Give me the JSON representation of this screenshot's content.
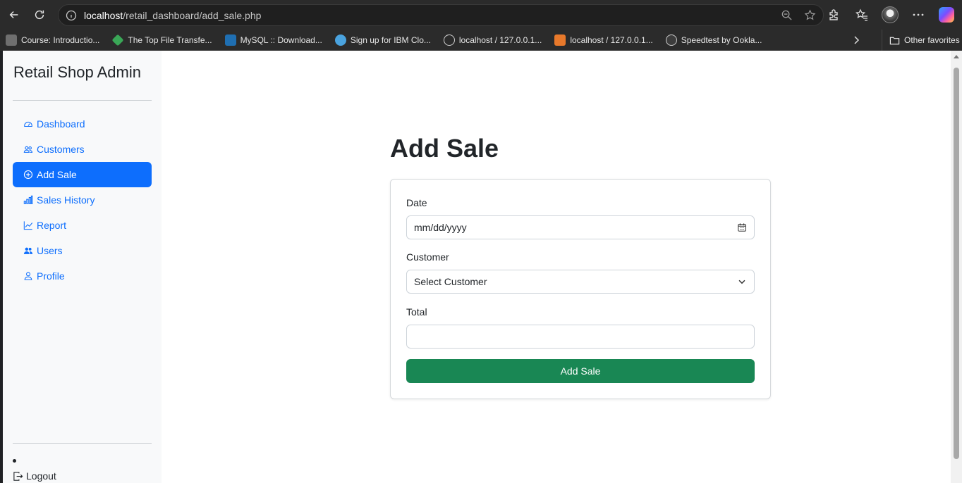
{
  "browser": {
    "url_host": "localhost",
    "url_path": "/retail_dashboard/add_sale.php",
    "bookmarks": [
      {
        "label": "Course: Introductio...",
        "color": "#6f6f6f"
      },
      {
        "label": "The Top File Transfe...",
        "color": "#3aa757"
      },
      {
        "label": "MySQL :: Download...",
        "color": "#1f6fb2"
      },
      {
        "label": "Sign up for IBM Clo...",
        "color": "#4aa3df"
      },
      {
        "label": "localhost / 127.0.0.1...",
        "color": "#8a8a8a"
      },
      {
        "label": "localhost / 127.0.0.1...",
        "color": "#e8792b"
      },
      {
        "label": "Speedtest by Ookla...",
        "color": "#3c3c3c"
      }
    ],
    "other_favorites": "Other favorites"
  },
  "sidebar": {
    "brand": "Retail Shop Admin",
    "items": [
      {
        "label": "Dashboard",
        "icon": "speedometer-icon",
        "active": false
      },
      {
        "label": "Customers",
        "icon": "people-icon",
        "active": false
      },
      {
        "label": "Add Sale",
        "icon": "plus-circle-icon",
        "active": true
      },
      {
        "label": "Sales History",
        "icon": "bar-chart-icon",
        "active": false
      },
      {
        "label": "Report",
        "icon": "line-chart-icon",
        "active": false
      },
      {
        "label": "Users",
        "icon": "people-fill-icon",
        "active": false
      },
      {
        "label": "Profile",
        "icon": "person-icon",
        "active": false
      }
    ],
    "logout": "Logout"
  },
  "main": {
    "title": "Add Sale",
    "form": {
      "date_label": "Date",
      "date_placeholder": "mm/dd/yyyy",
      "customer_label": "Customer",
      "customer_selected": "Select Customer",
      "total_label": "Total",
      "total_value": "",
      "submit_label": "Add Sale"
    }
  },
  "colors": {
    "primary": "#0d6efd",
    "success": "#198754"
  }
}
